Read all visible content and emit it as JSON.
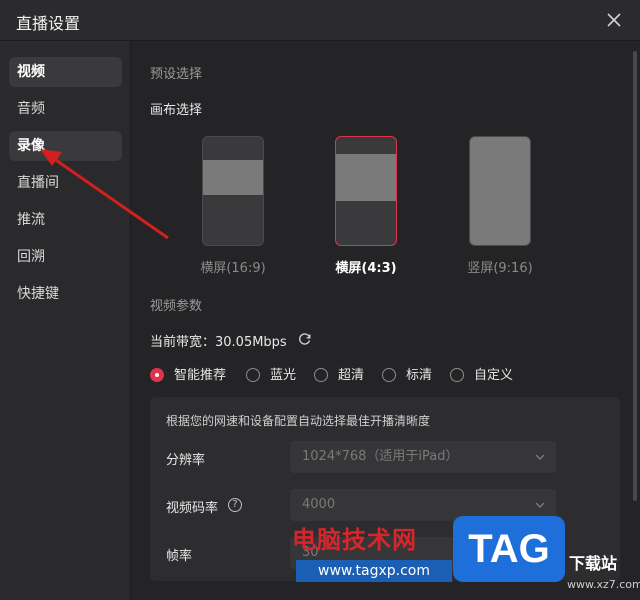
{
  "window": {
    "title": "直播设置",
    "close_icon": "close-icon"
  },
  "sidebar": {
    "items": [
      {
        "label": "视频",
        "active": true
      },
      {
        "label": "音频"
      },
      {
        "label": "录像",
        "hovered": true
      },
      {
        "label": "直播间"
      },
      {
        "label": "推流"
      },
      {
        "label": "回溯"
      },
      {
        "label": "快捷键"
      }
    ]
  },
  "preset": {
    "section_title": "预设选择",
    "canvas_label": "画布选择",
    "options": [
      {
        "label": "横屏(16:9)"
      },
      {
        "label": "横屏(4:3)",
        "selected": true
      },
      {
        "label": "竖屏(9:16)"
      }
    ]
  },
  "video_params": {
    "section_title": "视频参数",
    "bandwidth_label": "当前带宽：30.05Mbps",
    "refresh_icon": "refresh-icon",
    "quality_options": [
      {
        "label": "智能推荐",
        "checked": true
      },
      {
        "label": "蓝光"
      },
      {
        "label": "超清"
      },
      {
        "label": "标清"
      },
      {
        "label": "自定义"
      }
    ],
    "panel_hint": "根据您的网速和设备配置自动选择最佳开播清晰度",
    "resolution_label": "分辨率",
    "resolution_value": "1024*768（适用于iPad）",
    "bitrate_label": "视频码率",
    "bitrate_value": "4000",
    "framerate_label": "帧率",
    "framerate_value": "30"
  },
  "watermark": {
    "site_name": "电脑技术网",
    "site_url": "www.tagxp.com",
    "logo_text": "TAG",
    "download_text": "下载站",
    "download_url": "www.xz7.com"
  },
  "colors": {
    "accent": "#e0334d",
    "bg": "#242426",
    "sidebar": "#2a2a2c",
    "annotation_arrow": "#d21f1f"
  }
}
